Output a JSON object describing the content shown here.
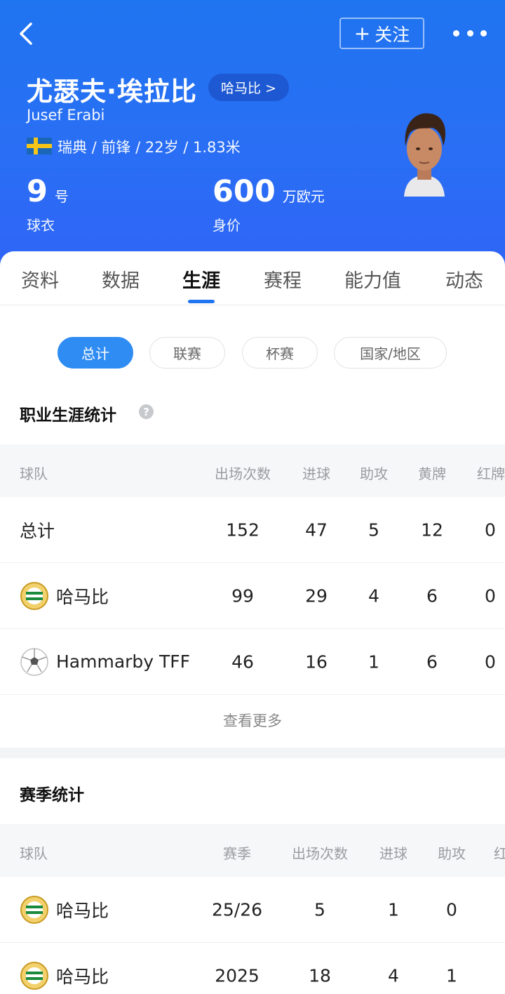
{
  "header": {
    "follow_label": "关注",
    "player_name": "尤瑟夫·埃拉比",
    "club_label": "哈马比 >",
    "english_name": "Jusef Erabi",
    "meta": "瑞典 / 前锋 / 22岁 / 1.83米",
    "shirt_number": "9",
    "shirt_unit": "号",
    "shirt_caption": "球衣",
    "value_number": "600",
    "value_unit": "万欧元",
    "value_caption": "身价"
  },
  "tabs": [
    "资料",
    "数据",
    "生涯",
    "赛程",
    "能力值",
    "动态"
  ],
  "active_tab": "生涯",
  "filters": [
    "总计",
    "联赛",
    "杯赛",
    "国家/地区"
  ],
  "active_filter": "总计",
  "career": {
    "title": "职业生涯统计",
    "columns": [
      "球队",
      "出场次数",
      "进球",
      "助攻",
      "黄牌",
      "红牌"
    ],
    "rows": [
      {
        "team": "总计",
        "logo": "none",
        "apps": "152",
        "goals": "47",
        "assists": "5",
        "yellow": "12",
        "red": "0"
      },
      {
        "team": "哈马比",
        "logo": "hammarby-crest-icon",
        "apps": "99",
        "goals": "29",
        "assists": "4",
        "yellow": "6",
        "red": "0"
      },
      {
        "team": "Hammarby TFF",
        "logo": "soccer-ball-icon",
        "apps": "46",
        "goals": "16",
        "assists": "1",
        "yellow": "6",
        "red": "0"
      }
    ],
    "more_label": "查看更多"
  },
  "season": {
    "title": "赛季统计",
    "columns": [
      "球队",
      "赛季",
      "出场次数",
      "进球",
      "助攻",
      "红"
    ],
    "rows": [
      {
        "team": "哈马比",
        "logo": "hammarby-crest-icon",
        "season": "25/26",
        "apps": "5",
        "goals": "1",
        "assists": "0"
      },
      {
        "team": "哈马比",
        "logo": "hammarby-crest-icon",
        "season": "2025",
        "apps": "18",
        "goals": "4",
        "assists": "1"
      }
    ]
  },
  "colors": {
    "header": "#2a6ef5",
    "accent": "#2f8cf2"
  }
}
